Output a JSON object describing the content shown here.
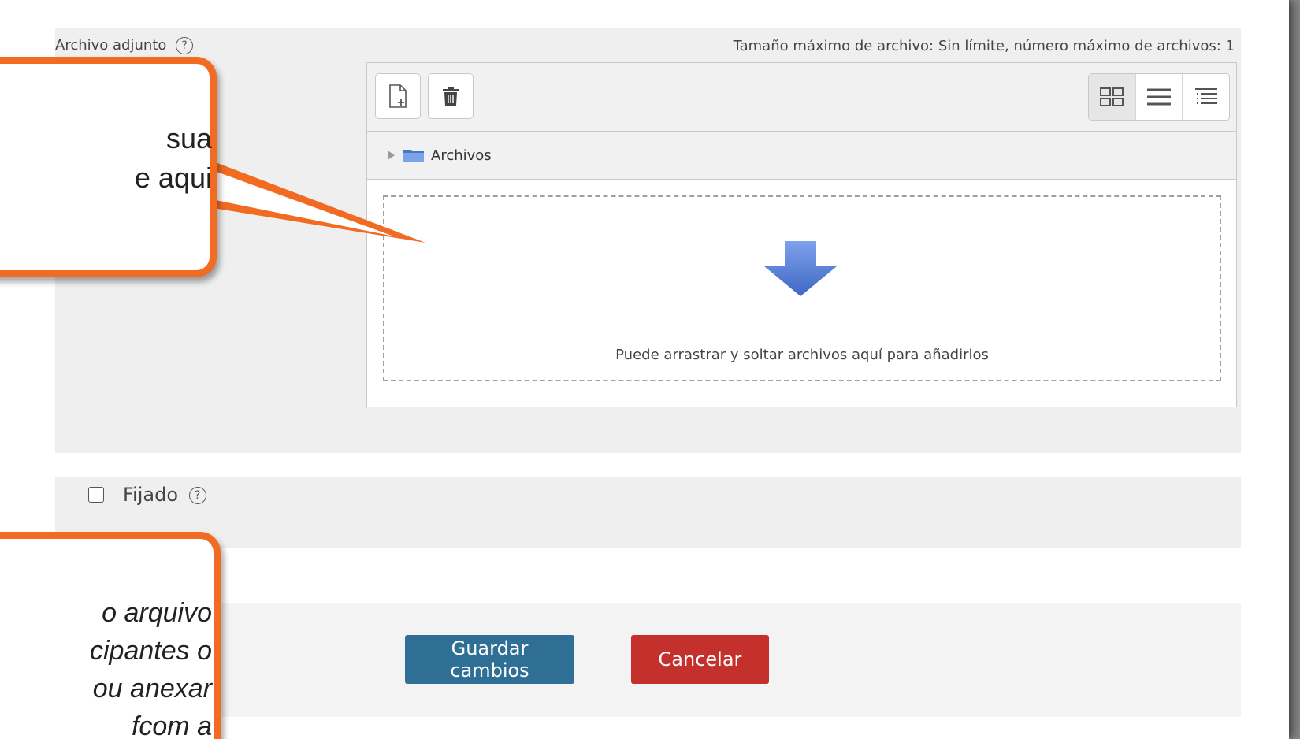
{
  "attachment": {
    "label": "Archivo adjunto",
    "help_icon": "?",
    "max_info": "Tamaño máximo de archivo: Sin límite, número máximo de archivos: 1"
  },
  "filepicker": {
    "toolbar": {
      "add_file_icon": "file-add-icon",
      "delete_icon": "trash-icon",
      "views": [
        "grid-view-icon",
        "list-view-icon",
        "tree-view-icon"
      ]
    },
    "path_label": "Archivos",
    "drop_message": "Puede arrastrar y soltar archivos aquí para añadirlos"
  },
  "pinned": {
    "label": "Fijado",
    "help_icon": "?",
    "checked": false
  },
  "actions": {
    "save_label": "Guardar cambios",
    "cancel_label": "Cancelar"
  },
  "callouts": {
    "top": "sua\ne aqui",
    "bottom": "o arquivo\ncipantes o\nou anexar\nfcom a"
  },
  "colors": {
    "accent_callout": "#f26b22",
    "save_button": "#2f6f96",
    "cancel_button": "#c4302b",
    "drop_arrow": "#5b82d4"
  }
}
